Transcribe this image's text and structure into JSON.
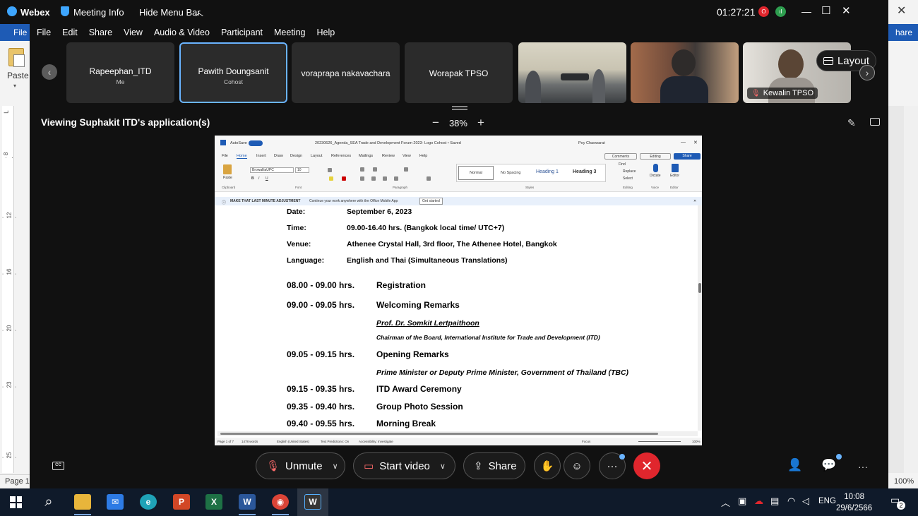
{
  "window": {
    "app_name": "Webex",
    "meeting_info": "Meeting Info",
    "hide_menu_bar": "Hide Menu Bar",
    "timer": "01:27:21"
  },
  "menu": {
    "items": [
      "File",
      "Edit",
      "Share",
      "View",
      "Audio & Video",
      "Participant",
      "Meeting",
      "Help"
    ]
  },
  "participants": {
    "tiles": [
      {
        "name": "Rapeephan_ITD",
        "role": "Me"
      },
      {
        "name": "Pawith Doungsanit",
        "role": "Cohost"
      },
      {
        "name": "voraprapa nakavachara",
        "role": ""
      },
      {
        "name": "Worapak TPSO",
        "role": ""
      }
    ],
    "video_label": "Kewalin TPSO",
    "layout_label": "Layout"
  },
  "viewbar": {
    "viewing_text": "Viewing Suphakit ITD's application(s)",
    "zoom": "38%",
    "zoom_out": "−",
    "zoom_in": "+"
  },
  "word": {
    "autosave": "AutoSave",
    "doc_title": "20230626_Agenda_SEA Trade and Development Forum 2023- Logo Cohost • Saved",
    "user": "Poy Chaowarat",
    "tabs": [
      "File",
      "Home",
      "Insert",
      "Draw",
      "Design",
      "Layout",
      "References",
      "Mailings",
      "Review",
      "View",
      "Help"
    ],
    "comments": "Comments",
    "editing": "Editing",
    "share": "Share",
    "font": "BrowalliaUPC",
    "size": "10",
    "paste": "Paste",
    "styles": [
      "Normal",
      "No Spacing",
      "Heading 1",
      "Heading 3"
    ],
    "groups": [
      "Clipboard",
      "Font",
      "Paragraph",
      "Styles",
      "Editing",
      "Voice",
      "Editor"
    ],
    "find": "Find",
    "replace": "Replace",
    "select": "Select",
    "dictate": "Dictate",
    "editor": "Editor",
    "notify_bold": "MAKE THAT LAST MINUTE ADJUSTMENT",
    "notify_text": "Continue your work anywhere with the Office Mobile App",
    "notify_btn": "Get started",
    "status": {
      "page": "Page 1 of 7",
      "words": "1478 words",
      "lang": "English (United States)",
      "predictions": "Text Predictions: On",
      "accessibility": "Accessibility: Investigate",
      "focus": "Focus",
      "zoom": "100%"
    }
  },
  "document": {
    "details": [
      {
        "label": "Date:",
        "value": "September 6, 2023"
      },
      {
        "label": "Time:",
        "value": "09.00-16.40 hrs. (Bangkok local time/ UTC+7)"
      },
      {
        "label": "Venue:",
        "value": "Athenee Crystal Hall, 3rd floor, The Athenee Hotel, Bangkok"
      },
      {
        "label": "Language:",
        "value": "English and Thai (Simultaneous Translations)"
      }
    ],
    "agenda": [
      {
        "time": "08.00 - 09.00 hrs.",
        "title": "Registration"
      },
      {
        "time": "09.00 - 09.05 hrs.",
        "title": "Welcoming Remarks"
      },
      {
        "time": "09.05 - 09.15 hrs.",
        "title": "Opening Remarks"
      },
      {
        "time": "09.15 - 09.35 hrs.",
        "title": "ITD Award Ceremony"
      },
      {
        "time": "09.35 - 09.40 hrs.",
        "title": "Group Photo Session"
      },
      {
        "time": "09.40 - 09.55 hrs.",
        "title": "Morning Break"
      }
    ],
    "speaker_name": "Prof. Dr. Somkit Lertpaithoon",
    "speaker_role": "Chairman of the Board, International Institute for Trade and Development (ITD)",
    "opening_speaker": "Prime Minister or Deputy Prime Minister, Government of Thailand (TBC)"
  },
  "controls": {
    "unmute": "Unmute",
    "start_video": "Start video",
    "share": "Share",
    "cc": "CC",
    "more": "···"
  },
  "background_word": {
    "file": "File",
    "paste": "Paste",
    "share": "hare",
    "page": "Page 1",
    "zoom": "100%"
  },
  "taskbar": {
    "lang": "ENG",
    "time": "10:08",
    "date": "29/6/2566",
    "notifications": "2"
  }
}
